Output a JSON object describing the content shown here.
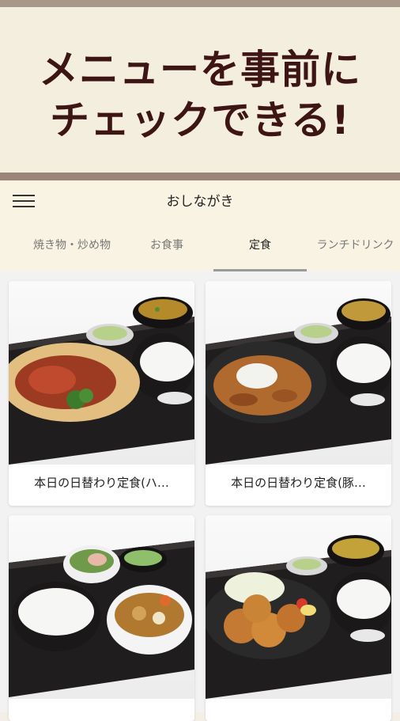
{
  "banner": {
    "line1": "メニューを事前に",
    "line2": "チェックできる!"
  },
  "header": {
    "title": "おしながき",
    "tabs": [
      {
        "label": "焼き物・炒め物"
      },
      {
        "label": "お食事"
      },
      {
        "label": "定食"
      },
      {
        "label": "ランチドリンク"
      }
    ]
  },
  "menu_items": [
    {
      "name": "本日の日替わり定食(ハ…"
    },
    {
      "name": "本日の日替わり定食(豚…"
    },
    {
      "name": ""
    },
    {
      "name": ""
    }
  ],
  "colors": {
    "banner_text": "#3d1515",
    "banner_bg": "#f4eede",
    "header_bg": "#f8f3e2",
    "tray": "#1f1d1d"
  }
}
